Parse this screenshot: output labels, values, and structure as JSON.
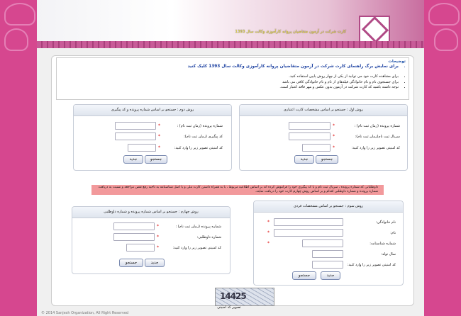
{
  "header": {
    "site_title": "کارت شرکت در آزمون متقاضیان پروانه کارآموزی وکالت سال 1393"
  },
  "notes": {
    "title": "توضیحات",
    "items": [
      "برای نمایش برگ راهنمای کارت شرکت در آزمون متقاضیان پروانه کارآموزی وکالت سال 1393 کلیک کنید",
      "برای مشاهده کارت خود می توانید از یکی از چهار روش پایین استفاده کنید.",
      "برای جستجوی نام و نام خانوادگی فیلدهای از نام و نام خانوادگی کافی می باشد",
      "توجه داشته باشید که کارت شرکت در آزمون بدون عکس و مهر فاقد اعتبار است."
    ]
  },
  "method1": {
    "title": "روش اول : جستجو بر اساس مشخصات کارت اعتباری",
    "f1": "شماره پرونده (زمان ثبت نام) :",
    "f2": "سریال ثبت نام(زمان ثبت نام):",
    "f3": "کد امنیتی تصویر زیر را وارد کنید:",
    "search": "جستجو",
    "new": "جدید"
  },
  "method2": {
    "title": "روش دوم : جستجو بر اساس شماره پرونده و کد پیگیری",
    "f1": "شماره پرونده (زمان ثبت نام) :",
    "f2": "کد پیگیری (زمان ثبت نام):",
    "f3": "کد امنیتی تصویر زیر را وارد کنید:",
    "search": "جستجو",
    "new": "جدید"
  },
  "warning": "داوطلبانی که شماره پرونده ، سریال ثبت نام و یا کد پیگیری خود را فراموش کرده اند بر اساس اطلاعیه مربوط ، با به همراه داشتن کارت ملی و یا اصل شناسنامه به ناحیه رفع نقص مراجعه و نسبت به دریافت شماره پرونده و شماره داوطلبی اقدام و بر اساس روش چهارم کارت خود را دریافت نمایند.",
  "method3": {
    "title": "روش سوم : جستجو بر اساس مشخصات فردی",
    "f1": "نام خانوادگی:",
    "f2": "نام:",
    "f3": "شماره شناسنامه:",
    "f4": "سال تولد:",
    "f5": "کد امنیتی تصویر زیر را وارد کنید:",
    "search": "جستجو",
    "new": "جدید"
  },
  "method4": {
    "title": "روش چهارم : جستجو بر اساس شماره پرونده و شماره داوطلبی",
    "f1": "شماره پرونده (زمان ثبت نام) :",
    "f2": "شماره داوطلبی:",
    "f3": "کد امنیتی تصویر زیر را وارد کنید:",
    "search": "جستجو",
    "new": "جدید"
  },
  "captcha": {
    "code": "14425",
    "label": "تصویر کد امنیتی"
  },
  "footer": "© 2014 Sanjesh Organization, All Right Reserved"
}
